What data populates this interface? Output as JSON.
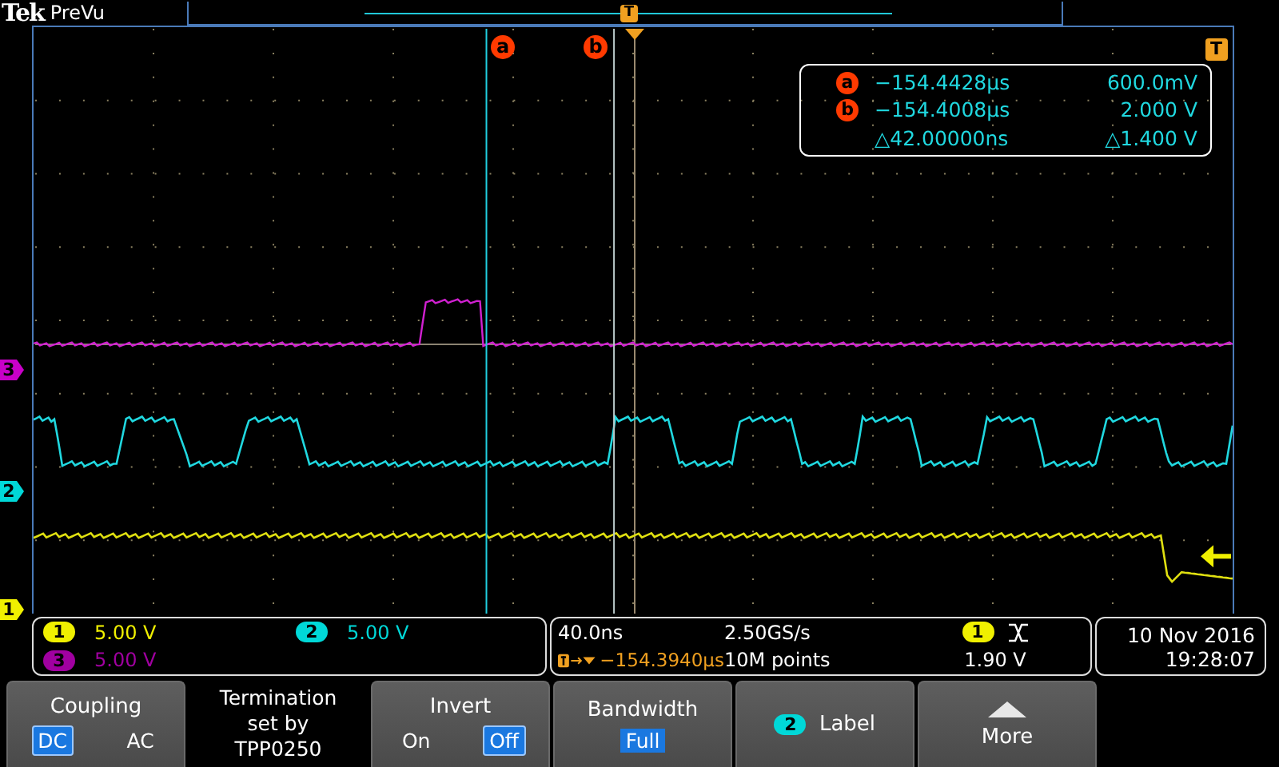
{
  "header": {
    "brand": "Tek",
    "mode": "PreVu",
    "trigger_marker": "T"
  },
  "cursors": [
    {
      "label": "a"
    },
    {
      "label": "b"
    }
  ],
  "trigger_marker": "T",
  "readout": {
    "rows": [
      {
        "cursor": "a",
        "time": "−154.4428µs",
        "value": "600.0mV"
      },
      {
        "cursor": "b",
        "time": "−154.4008µs",
        "value": "2.000 V"
      }
    ],
    "delta": {
      "time": "△42.00000ns",
      "value": "△1.400 V"
    }
  },
  "channel_markers": [
    {
      "label": "3",
      "color": "#c800c8"
    },
    {
      "label": "2",
      "color": "#00d8d8"
    },
    {
      "label": "1",
      "color": "#f0f000"
    }
  ],
  "channels": [
    {
      "badge": "1",
      "scale": "5.00 V",
      "color": "#f0f000"
    },
    {
      "badge": "2",
      "scale": "5.00 V",
      "color": "#00d8d8"
    },
    {
      "badge": "3",
      "scale": "5.00 V",
      "color": "#a000a0"
    }
  ],
  "timebase": {
    "scale": "40.0ns",
    "trigger_position": "−154.3940µs",
    "sample_rate": "2.50GS/s",
    "record_length": "10M points"
  },
  "trigger": {
    "source": "1",
    "level": "1.90 V"
  },
  "datetime": {
    "date": "10 Nov 2016",
    "time": "19:28:07"
  },
  "softkeys": [
    {
      "kind": "options",
      "title": "Coupling",
      "options": [
        {
          "label": "DC",
          "selected": true
        },
        {
          "label": "AC",
          "selected": false
        }
      ]
    },
    {
      "kind": "text",
      "lines": [
        "Termination",
        "set by",
        "TPP0250"
      ]
    },
    {
      "kind": "options",
      "title": "Invert",
      "options": [
        {
          "label": "On",
          "selected": false
        },
        {
          "label": "Off",
          "selected": true
        }
      ]
    },
    {
      "kind": "value",
      "title": "Bandwidth",
      "value": "Full"
    },
    {
      "kind": "badge",
      "badge": "2",
      "title": "Label"
    },
    {
      "kind": "more",
      "title": "More"
    }
  ]
}
